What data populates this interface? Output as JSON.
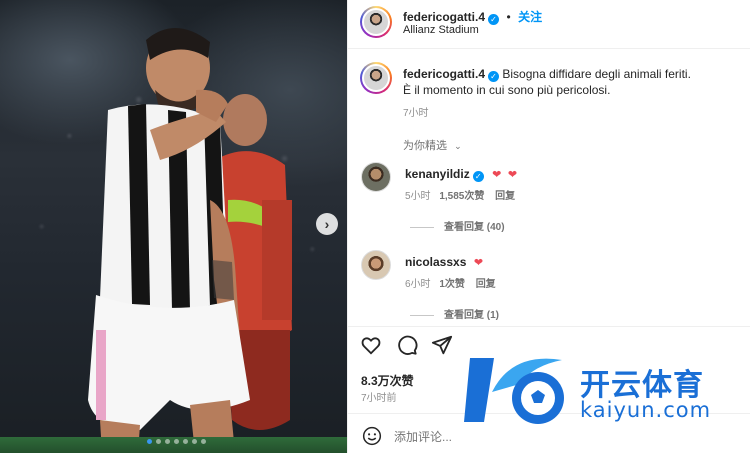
{
  "post": {
    "author": "federicogatti.4",
    "follow_label": "关注",
    "location": "Allianz Stadium",
    "caption_text": "Bisogna diffidare degli animali feriti. È il momento in cui sono più pericolosi.",
    "caption_line1": "Bisogna diffidare degli animali feriti.",
    "caption_line2": "È il momento in cui sono più pericolosi.",
    "caption_time": "7小时",
    "sort_label": "为你精选",
    "likes": "8.3万次赞",
    "time_ago": "7小时前",
    "add_comment_placeholder": "添加评论...",
    "slide_index": 1,
    "slide_count": 7
  },
  "comments": [
    {
      "user": "kenanyildiz",
      "verified": true,
      "hearts": 2,
      "time": "5小时",
      "likes": "1,585次赞",
      "reply_label": "回复",
      "view_replies": "查看回复 (40)"
    },
    {
      "user": "nicolassxs",
      "verified": false,
      "hearts": 1,
      "time": "6小时",
      "likes": "1次赞",
      "reply_label": "回复",
      "view_replies": "查看回复 (1)"
    }
  ],
  "icons": [
    "heart-icon",
    "comment-icon",
    "share-icon",
    "emoji-icon",
    "chevron-down-icon",
    "next-arrow-icon",
    "verified-icon"
  ],
  "colors": {
    "accent": "#0095f6",
    "heart": "#ed4956",
    "watermark": "#1a6fd6"
  },
  "watermark": {
    "title": "开云体育",
    "subtitle": "kaiyun.com"
  }
}
